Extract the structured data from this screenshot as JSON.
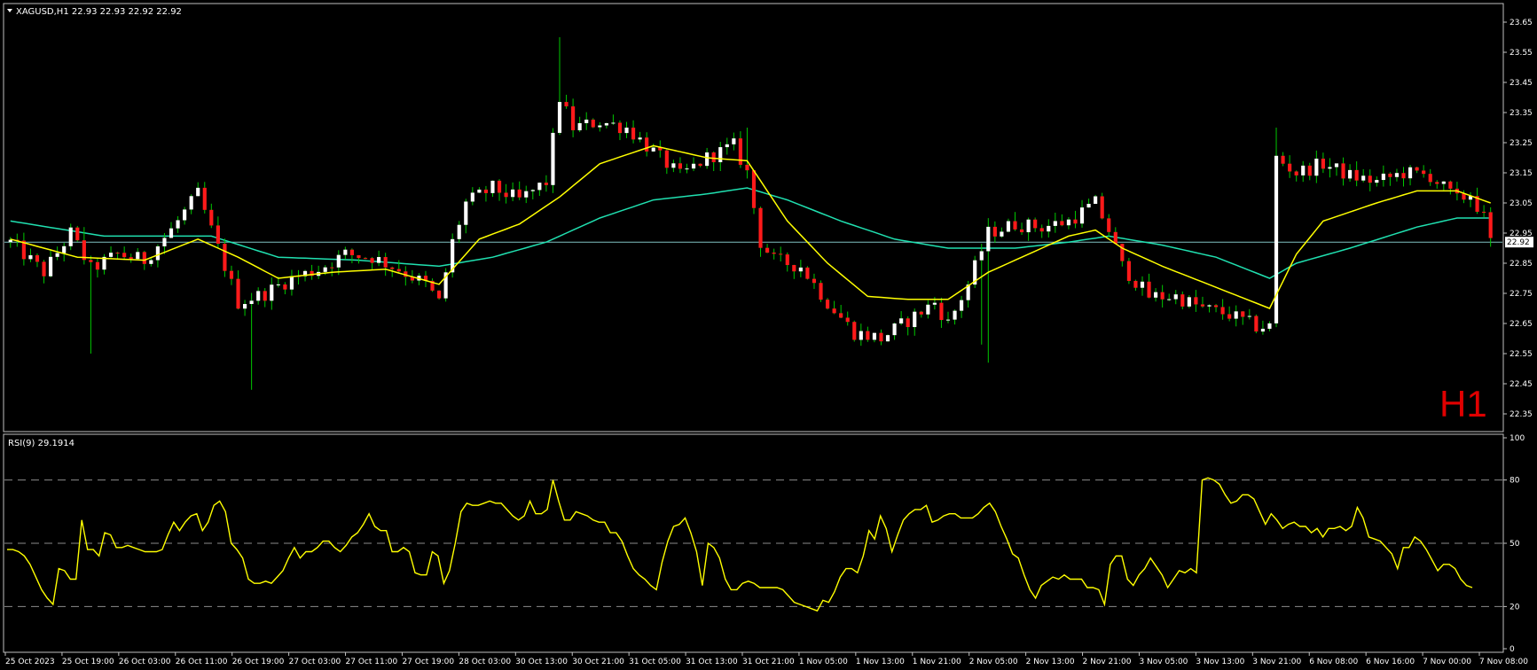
{
  "header": {
    "dropdown_icon": "triangle-down-icon",
    "title": "XAGUSD,H1  22.93 22.93 22.92 22.92"
  },
  "timeframe_label": "H1",
  "rsi_header": "RSI(9) 29.1914",
  "current_price_tag": "22.92",
  "colors": {
    "background": "#000000",
    "frame": "#c0c0c0",
    "bull": "#ffffff",
    "bear": "#ff1a1a",
    "wick": "#00c800",
    "ma_fast": "#ffff00",
    "ma_slow": "#20e0b0",
    "rsi": "#ffff00",
    "timeframe": "#e00000",
    "price_line": "#7fbfbf"
  },
  "chart_data": [
    {
      "type": "candlestick",
      "symbol": "XAGUSD",
      "timeframe": "H1",
      "ylim": [
        22.3,
        23.7
      ],
      "y_ticks": [
        "23.65",
        "23.55",
        "23.45",
        "23.35",
        "23.25",
        "23.15",
        "23.05",
        "22.95",
        "22.85",
        "22.75",
        "22.65",
        "22.55",
        "22.45",
        "22.35"
      ],
      "x_ticks": [
        "25 Oct 2023",
        "25 Oct 19:00",
        "26 Oct 03:00",
        "26 Oct 11:00",
        "26 Oct 19:00",
        "27 Oct 03:00",
        "27 Oct 11:00",
        "27 Oct 19:00",
        "28 Oct 03:00",
        "30 Oct 13:00",
        "30 Oct 21:00",
        "31 Oct 05:00",
        "31 Oct 13:00",
        "31 Oct 21:00",
        "1 Nov 05:00",
        "1 Nov 13:00",
        "1 Nov 21:00",
        "2 Nov 05:00",
        "2 Nov 13:00",
        "2 Nov 21:00",
        "3 Nov 05:00",
        "3 Nov 13:00",
        "3 Nov 21:00",
        "6 Nov 08:00",
        "6 Nov 16:00",
        "7 Nov 00:00",
        "7 Nov 08:00"
      ],
      "last_price": 22.92,
      "close_anchors": [
        [
          0,
          22.92
        ],
        [
          5,
          22.82
        ],
        [
          9,
          22.95
        ],
        [
          12,
          22.83
        ],
        [
          16,
          22.88
        ],
        [
          20,
          22.86
        ],
        [
          24,
          22.96
        ],
        [
          28,
          23.08
        ],
        [
          30,
          22.96
        ],
        [
          34,
          22.72
        ],
        [
          38,
          22.75
        ],
        [
          42,
          22.8
        ],
        [
          46,
          22.83
        ],
        [
          50,
          22.88
        ],
        [
          54,
          22.87
        ],
        [
          58,
          22.83
        ],
        [
          62,
          22.78
        ],
        [
          64,
          22.72
        ],
        [
          66,
          22.92
        ],
        [
          68,
          23.05
        ],
        [
          72,
          23.1
        ],
        [
          76,
          23.06
        ],
        [
          80,
          23.12
        ],
        [
          82,
          23.4
        ],
        [
          84,
          23.3
        ],
        [
          88,
          23.32
        ],
        [
          92,
          23.3
        ],
        [
          96,
          23.22
        ],
        [
          100,
          23.14
        ],
        [
          104,
          23.2
        ],
        [
          108,
          23.24
        ],
        [
          110,
          23.15
        ],
        [
          112,
          22.92
        ],
        [
          114,
          22.86
        ],
        [
          118,
          22.84
        ],
        [
          122,
          22.72
        ],
        [
          126,
          22.62
        ],
        [
          130,
          22.6
        ],
        [
          134,
          22.66
        ],
        [
          138,
          22.72
        ],
        [
          140,
          22.65
        ],
        [
          143,
          22.78
        ],
        [
          146,
          22.95
        ],
        [
          150,
          22.98
        ],
        [
          154,
          22.97
        ],
        [
          158,
          22.99
        ],
        [
          162,
          23.05
        ],
        [
          164,
          22.96
        ],
        [
          166,
          22.84
        ],
        [
          170,
          22.74
        ],
        [
          174,
          22.74
        ],
        [
          178,
          22.7
        ],
        [
          182,
          22.68
        ],
        [
          186,
          22.64
        ],
        [
          188,
          22.64
        ],
        [
          189,
          23.2
        ],
        [
          192,
          23.15
        ],
        [
          196,
          23.18
        ],
        [
          200,
          23.14
        ],
        [
          204,
          23.12
        ],
        [
          208,
          23.15
        ],
        [
          212,
          23.14
        ],
        [
          216,
          23.06
        ],
        [
          218,
          23.08
        ],
        [
          220,
          23.0
        ],
        [
          221,
          22.92
        ]
      ],
      "high_spikes": [
        [
          82,
          23.6
        ],
        [
          110,
          23.3
        ],
        [
          189,
          23.3
        ],
        [
          11,
          22.97
        ],
        [
          150,
          23.02
        ]
      ],
      "low_spikes": [
        [
          12,
          22.55
        ],
        [
          36,
          22.43
        ],
        [
          145,
          22.58
        ],
        [
          146,
          22.52
        ]
      ],
      "moving_averages": [
        {
          "name": "MA fast",
          "points": [
            [
              0,
              22.93
            ],
            [
              10,
              22.87
            ],
            [
              20,
              22.86
            ],
            [
              28,
              22.93
            ],
            [
              34,
              22.87
            ],
            [
              40,
              22.8
            ],
            [
              48,
              22.82
            ],
            [
              56,
              22.83
            ],
            [
              64,
              22.78
            ],
            [
              70,
              22.93
            ],
            [
              76,
              22.98
            ],
            [
              82,
              23.07
            ],
            [
              88,
              23.18
            ],
            [
              96,
              23.24
            ],
            [
              104,
              23.2
            ],
            [
              110,
              23.19
            ],
            [
              116,
              22.99
            ],
            [
              122,
              22.85
            ],
            [
              128,
              22.74
            ],
            [
              134,
              22.73
            ],
            [
              140,
              22.73
            ],
            [
              146,
              22.82
            ],
            [
              152,
              22.88
            ],
            [
              158,
              22.94
            ],
            [
              162,
              22.96
            ],
            [
              166,
              22.9
            ],
            [
              172,
              22.84
            ],
            [
              180,
              22.77
            ],
            [
              188,
              22.7
            ],
            [
              192,
              22.88
            ],
            [
              196,
              22.99
            ],
            [
              204,
              23.05
            ],
            [
              210,
              23.09
            ],
            [
              216,
              23.09
            ],
            [
              221,
              23.05
            ]
          ]
        },
        {
          "name": "MA slow",
          "points": [
            [
              0,
              22.99
            ],
            [
              14,
              22.94
            ],
            [
              30,
              22.94
            ],
            [
              40,
              22.87
            ],
            [
              52,
              22.86
            ],
            [
              64,
              22.84
            ],
            [
              72,
              22.87
            ],
            [
              80,
              22.92
            ],
            [
              88,
              23.0
            ],
            [
              96,
              23.06
            ],
            [
              104,
              23.08
            ],
            [
              110,
              23.1
            ],
            [
              116,
              23.06
            ],
            [
              124,
              22.99
            ],
            [
              132,
              22.93
            ],
            [
              140,
              22.9
            ],
            [
              150,
              22.9
            ],
            [
              158,
              22.92
            ],
            [
              164,
              22.94
            ],
            [
              172,
              22.91
            ],
            [
              180,
              22.87
            ],
            [
              188,
              22.8
            ],
            [
              192,
              22.85
            ],
            [
              200,
              22.9
            ],
            [
              210,
              22.97
            ],
            [
              216,
              23.0
            ],
            [
              221,
              23.0
            ]
          ]
        }
      ]
    },
    {
      "type": "line",
      "name": "RSI(9)",
      "ylim": [
        0,
        100
      ],
      "y_ticks": [
        "100",
        "80",
        "50",
        "20",
        "0"
      ],
      "levels": [
        80,
        50,
        20
      ],
      "last_value": 29.1914,
      "values": [
        47,
        47,
        46,
        44,
        40,
        34,
        28,
        24,
        21,
        38,
        37,
        33,
        33,
        61,
        47,
        47,
        44,
        55,
        54,
        48,
        48,
        49,
        48,
        47,
        46,
        46,
        46,
        47,
        54,
        60,
        56,
        60,
        63,
        64,
        56,
        60,
        68,
        70,
        65,
        50,
        47,
        43,
        33,
        31,
        31,
        32,
        31,
        34,
        37,
        43,
        48,
        43,
        46,
        46,
        48,
        51,
        51,
        48,
        46,
        49,
        53,
        55,
        59,
        64,
        58,
        56,
        56,
        46,
        46,
        48,
        46,
        36,
        35,
        35,
        46,
        44,
        31,
        37,
        50,
        65,
        69,
        68,
        68,
        69,
        70,
        69,
        69,
        66,
        63,
        61,
        63,
        70,
        64,
        64,
        66,
        80,
        70,
        61,
        61,
        65,
        64,
        63,
        61,
        60,
        60,
        55,
        55,
        51,
        44,
        38,
        35,
        33,
        30,
        28,
        41,
        51,
        58,
        59,
        62,
        55,
        46,
        30,
        50,
        48,
        43,
        33,
        28,
        28,
        31,
        32,
        31,
        29,
        29,
        29,
        29,
        28,
        25,
        22,
        21,
        20,
        19,
        18,
        23,
        22,
        27,
        34,
        38,
        38,
        36,
        44,
        56,
        52,
        63,
        57,
        46,
        54,
        61,
        64,
        66,
        66,
        68,
        60,
        61,
        63,
        64,
        64,
        62,
        62,
        62,
        64,
        67,
        69,
        65,
        58,
        52,
        45,
        43,
        35,
        28,
        24,
        30,
        32,
        34,
        33,
        35,
        33,
        33,
        33,
        29,
        29,
        28,
        21,
        40,
        44,
        44,
        33,
        30,
        35,
        38,
        43,
        39,
        35,
        29,
        33,
        37,
        36,
        38,
        36,
        80,
        81,
        80,
        78,
        73,
        69,
        70,
        73,
        73,
        71,
        65,
        59,
        64,
        61,
        57,
        59,
        60,
        58,
        58,
        55,
        57,
        53,
        57,
        57,
        58,
        56,
        58,
        67,
        62,
        53,
        52,
        51,
        48,
        45,
        38,
        48,
        48,
        53,
        51,
        47,
        42,
        37,
        40,
        40,
        38,
        33,
        30,
        29
      ]
    }
  ]
}
